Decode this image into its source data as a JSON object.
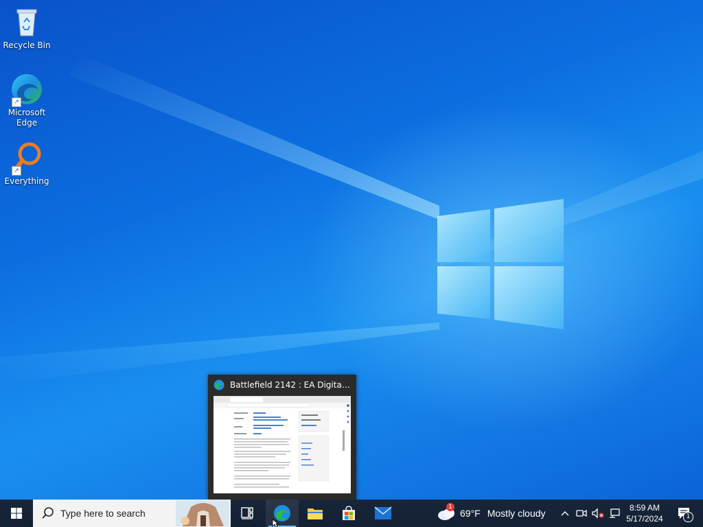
{
  "desktop": {
    "icons": [
      {
        "label": "Recycle Bin"
      },
      {
        "label": "Microsoft\nEdge"
      },
      {
        "label": "Everything"
      }
    ]
  },
  "preview": {
    "title": "Battlefield 2142 : EA Digital Illusi..."
  },
  "taskbar": {
    "search_placeholder": "Type here to search",
    "weather": {
      "temp": "69°F",
      "condition": "Mostly cloudy",
      "badge": "1"
    },
    "clock": {
      "time": "8:59 AM",
      "date": "5/17/2024"
    },
    "notification_count": "1"
  },
  "colors": {
    "accent": "#0b6ee0",
    "taskbar": "#18263a",
    "active_indicator": "#76b9ed"
  }
}
